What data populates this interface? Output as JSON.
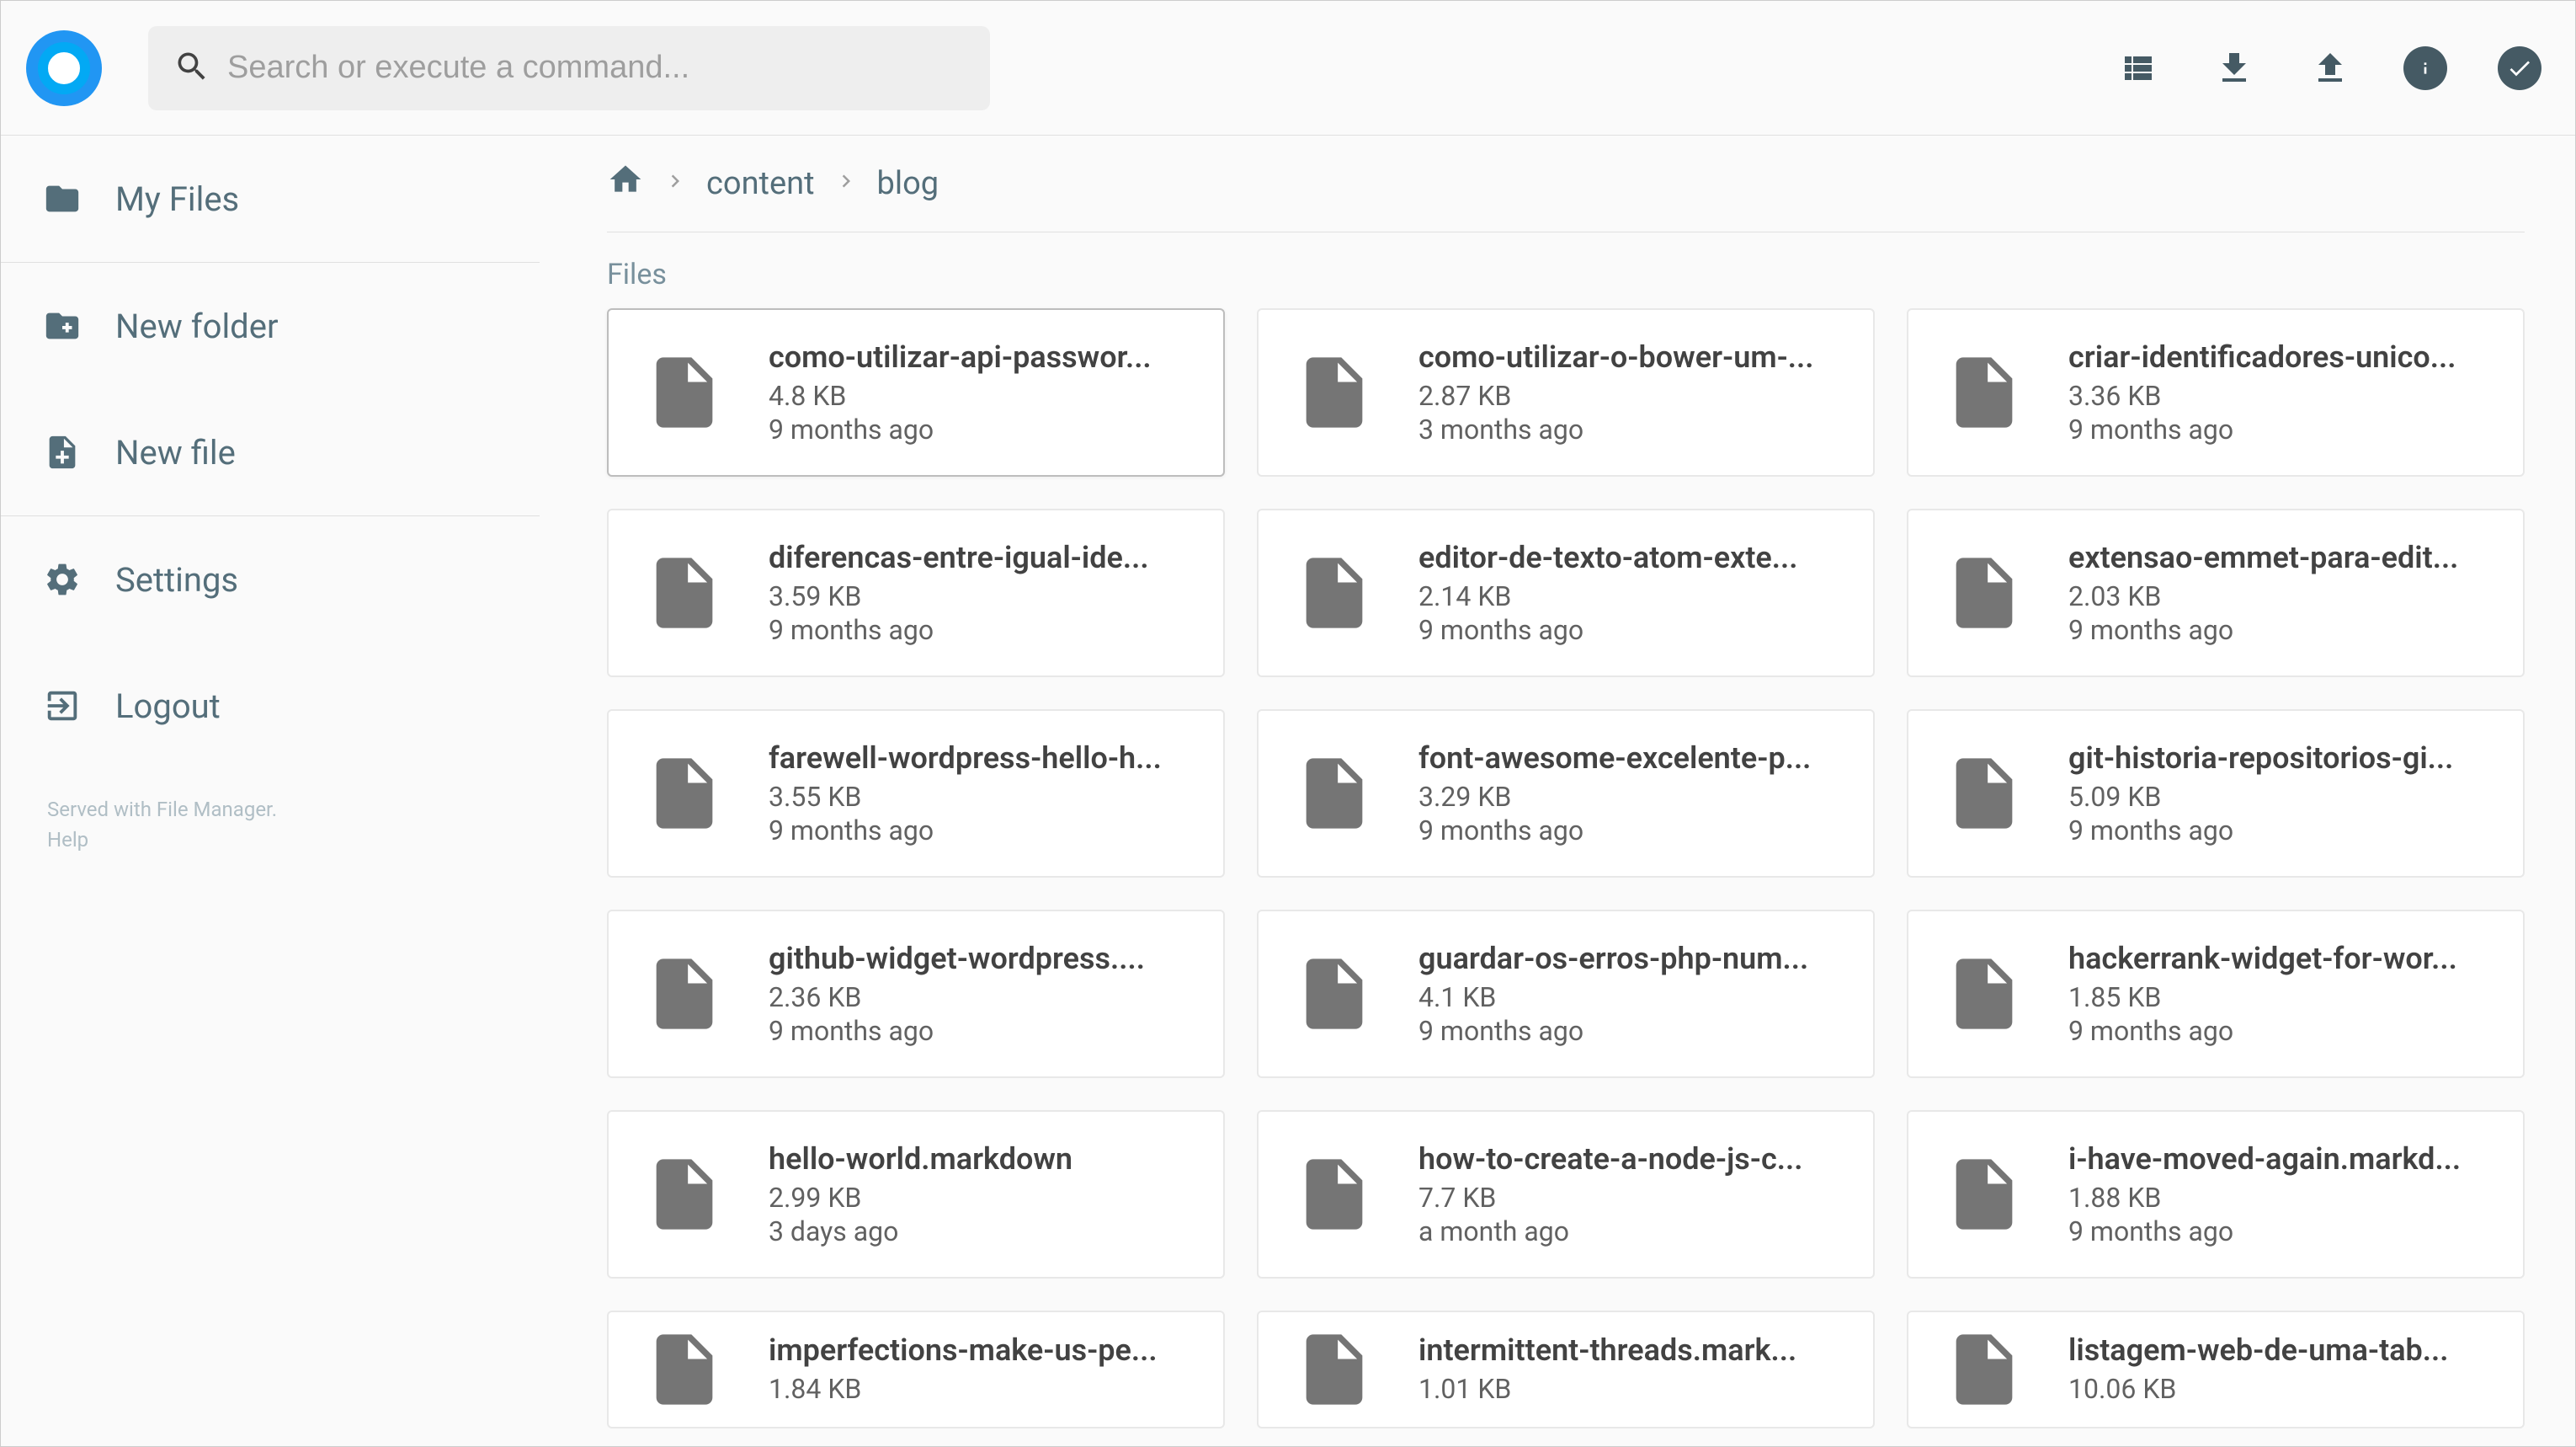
{
  "search": {
    "placeholder": "Search or execute a command..."
  },
  "sidebar": {
    "items": [
      {
        "label": "My Files"
      },
      {
        "label": "New folder"
      },
      {
        "label": "New file"
      },
      {
        "label": "Settings"
      },
      {
        "label": "Logout"
      }
    ],
    "footer": {
      "line1": "Served with File Manager.",
      "line2": "Help"
    }
  },
  "breadcrumb": {
    "segments": [
      {
        "label": "content"
      },
      {
        "label": "blog"
      }
    ]
  },
  "section_label": "Files",
  "files": [
    {
      "name": "como-utilizar-api-passwor...",
      "size": "4.8 KB",
      "age": "9 months ago"
    },
    {
      "name": "como-utilizar-o-bower-um-...",
      "size": "2.87 KB",
      "age": "3 months ago"
    },
    {
      "name": "criar-identificadores-unico...",
      "size": "3.36 KB",
      "age": "9 months ago"
    },
    {
      "name": "diferencas-entre-igual-ide...",
      "size": "3.59 KB",
      "age": "9 months ago"
    },
    {
      "name": "editor-de-texto-atom-exte...",
      "size": "2.14 KB",
      "age": "9 months ago"
    },
    {
      "name": "extensao-emmet-para-edit...",
      "size": "2.03 KB",
      "age": "9 months ago"
    },
    {
      "name": "farewell-wordpress-hello-h...",
      "size": "3.55 KB",
      "age": "9 months ago"
    },
    {
      "name": "font-awesome-excelente-p...",
      "size": "3.29 KB",
      "age": "9 months ago"
    },
    {
      "name": "git-historia-repositorios-gi...",
      "size": "5.09 KB",
      "age": "9 months ago"
    },
    {
      "name": "github-widget-wordpress....",
      "size": "2.36 KB",
      "age": "9 months ago"
    },
    {
      "name": "guardar-os-erros-php-num...",
      "size": "4.1 KB",
      "age": "9 months ago"
    },
    {
      "name": "hackerrank-widget-for-wor...",
      "size": "1.85 KB",
      "age": "9 months ago"
    },
    {
      "name": "hello-world.markdown",
      "size": "2.99 KB",
      "age": "3 days ago"
    },
    {
      "name": "how-to-create-a-node-js-c...",
      "size": "7.7 KB",
      "age": "a month ago"
    },
    {
      "name": "i-have-moved-again.markd...",
      "size": "1.88 KB",
      "age": "9 months ago"
    },
    {
      "name": "imperfections-make-us-pe...",
      "size": "1.84 KB",
      "age": ""
    },
    {
      "name": "intermittent-threads.mark...",
      "size": "1.01 KB",
      "age": ""
    },
    {
      "name": "listagem-web-de-uma-tab...",
      "size": "10.06 KB",
      "age": ""
    }
  ]
}
